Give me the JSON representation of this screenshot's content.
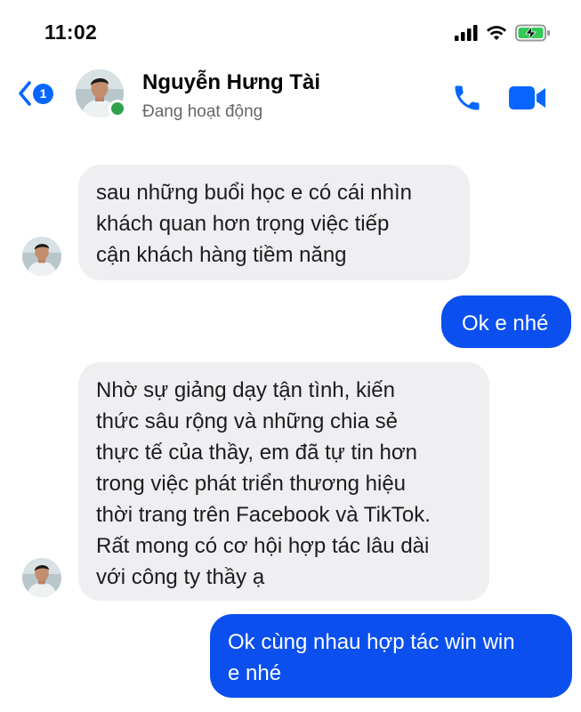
{
  "status_bar": {
    "time": "11:02",
    "icons": [
      "cellular-signal-icon",
      "wifi-icon",
      "battery-charging-icon"
    ]
  },
  "header": {
    "back_badge": "1",
    "contact_name": "Nguyễn Hưng Tài",
    "contact_status": "Đang hoạt động",
    "icons": [
      "back-chevron-icon",
      "phone-icon",
      "video-camera-icon"
    ]
  },
  "colors": {
    "accent": "#0866ff",
    "outgoing_bubble": "#0b4fee",
    "incoming_bubble": "#efeff1",
    "online": "#31a24c"
  },
  "messages": [
    {
      "direction": "incoming",
      "lines": [
        "sau những buổi học e có cái nhìn",
        "khách quan hơn trọng việc tiếp",
        "cận khách hàng tiềm năng"
      ]
    },
    {
      "direction": "outgoing",
      "lines": [
        "Ok e nhé"
      ]
    },
    {
      "direction": "incoming",
      "lines": [
        "Nhờ sự giảng dạy tận tình, kiến",
        "thức sâu rộng và những chia sẻ",
        "thực tế của thầy, em đã tự tin hơn",
        "trong việc phát triển thương hiệu",
        "thời trang trên Facebook và TikTok.",
        "Rất mong có cơ hội hợp tác lâu dài",
        "với công ty thầy ạ"
      ]
    },
    {
      "direction": "outgoing",
      "lines": [
        "Ok cùng nhau hợp tác win win",
        "e nhé"
      ]
    }
  ]
}
